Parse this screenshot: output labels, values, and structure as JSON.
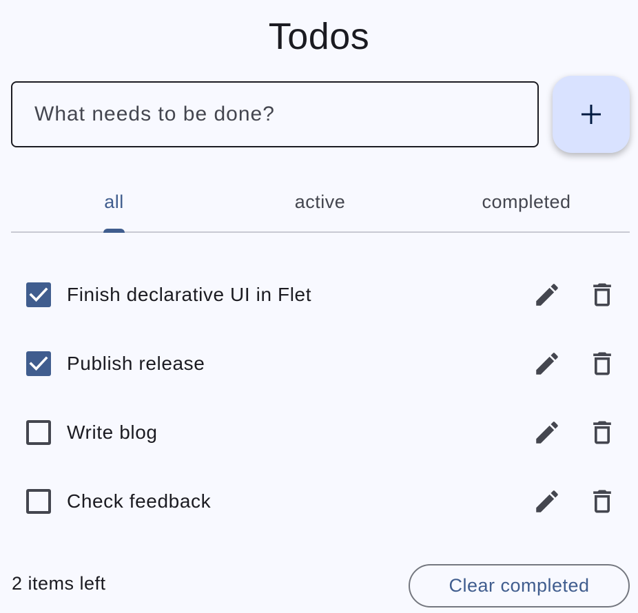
{
  "header": {
    "title": "Todos"
  },
  "new_task": {
    "placeholder": "What needs to be done?",
    "value": "",
    "add_icon": "plus-icon"
  },
  "tabs": [
    {
      "label": "all",
      "selected": true
    },
    {
      "label": "active",
      "selected": false
    },
    {
      "label": "completed",
      "selected": false
    }
  ],
  "tasks": [
    {
      "label": "Finish declarative UI in Flet",
      "completed": true
    },
    {
      "label": "Publish release",
      "completed": true
    },
    {
      "label": "Write blog",
      "completed": false
    },
    {
      "label": "Check feedback",
      "completed": false
    }
  ],
  "task_actions": {
    "edit_icon": "pencil-icon",
    "delete_icon": "trash-icon"
  },
  "footer": {
    "items_left": "2 items left",
    "clear_label": "Clear completed"
  },
  "colors": {
    "background": "#f8f9ff",
    "primary": "#405d8e",
    "fab_background": "#d9e2ff",
    "text": "#1b1b21",
    "icon": "#44464f",
    "divider": "#c8c9d2"
  }
}
